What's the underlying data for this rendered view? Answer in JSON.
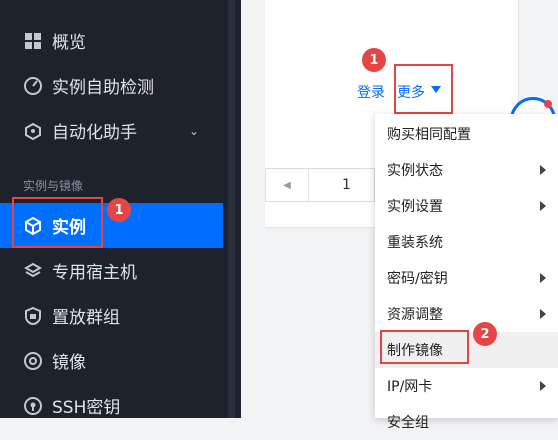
{
  "sidebar": {
    "items": [
      {
        "label": "概览",
        "icon": "grid-icon"
      },
      {
        "label": "实例自助检测",
        "icon": "gauge-icon"
      },
      {
        "label": "自动化助手",
        "icon": "robot-icon",
        "chevron": "⌄"
      },
      {
        "label": "实例",
        "icon": "cube-icon"
      },
      {
        "label": "专用宿主机",
        "icon": "layers-icon"
      },
      {
        "label": "置放群组",
        "icon": "shield-cube-icon"
      },
      {
        "label": "镜像",
        "icon": "disc-icon"
      },
      {
        "label": "SSH密钥",
        "icon": "key-icon"
      }
    ],
    "group_label": "实例与镜像",
    "active_item": "实例"
  },
  "toolbar": {
    "login_label": "登录",
    "more_label": "更多"
  },
  "pager": {
    "page": "1"
  },
  "menu": {
    "items": [
      {
        "label": "购买相同配置",
        "has_sub": false
      },
      {
        "label": "实例状态",
        "has_sub": true
      },
      {
        "label": "实例设置",
        "has_sub": true
      },
      {
        "label": "重装系统",
        "has_sub": false
      },
      {
        "label": "密码/密钥",
        "has_sub": true
      },
      {
        "label": "资源调整",
        "has_sub": true
      },
      {
        "label": "制作镜像",
        "has_sub": false
      },
      {
        "label": "IP/网卡",
        "has_sub": true
      },
      {
        "label": "安全组",
        "has_sub": false
      }
    ]
  },
  "markers": {
    "sidebar_step": "1",
    "more_step": "1",
    "menu_step": "2"
  },
  "colors": {
    "sidebar_bg": "#1e222d",
    "accent": "#006eff",
    "highlight_red": "#e54545"
  }
}
